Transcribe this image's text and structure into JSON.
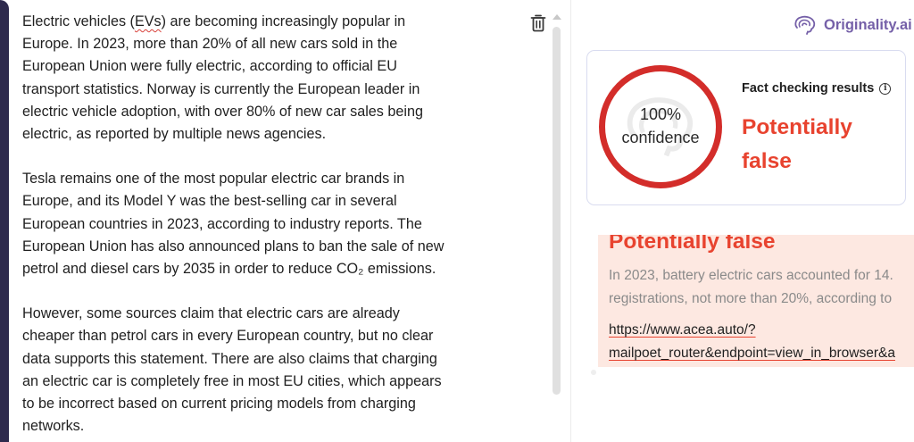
{
  "editor": {
    "paragraphs": [
      {
        "lines": [
          "Electric vehicles (EVs) are becoming increasingly popular in",
          "Europe. In 2023, more than 20% of all new cars sold in the",
          "European Union were fully electric, according to official EU",
          "transport statistics. Norway is currently the European leader in",
          "electric vehicle adoption, with over 80% of new car sales being",
          "electric, as reported by multiple news agencies."
        ],
        "line0_before": "Electric vehicles (",
        "line0_misspelled": "EVs",
        "line0_after": ") are becoming increasingly popular in"
      },
      {
        "lines": [
          "Tesla remains one of the most popular electric car brands in",
          "Europe, and its Model Y was the best-selling car in several",
          "European countries in 2023, according to industry reports. The",
          "European Union has also announced plans to ban the sale of new",
          "petrol and diesel cars by 2035 in order to reduce CO₂ emissions."
        ]
      },
      {
        "lines": [
          "However, some sources claim that electric cars are already",
          "cheaper than petrol cars in every European country, but no clear",
          "data supports this statement. There are also claims that charging",
          "an electric car is completely free in most EU cities, which appears",
          "to be incorrect based on current pricing models from charging",
          "networks."
        ]
      }
    ],
    "delete_icon": "trash-icon"
  },
  "brand": {
    "name": "Originality.ai",
    "icon": "brain-icon",
    "color": "#7560a8"
  },
  "fact_check": {
    "confidence_value": "100%",
    "confidence_label": "confidence",
    "title": "Fact checking results",
    "info_icon": "info-icon",
    "info_glyph": "i",
    "verdict_line1": "Potentially",
    "verdict_line2": "false",
    "verdict_color": "#e8432f",
    "ring_color": "#d32d2a"
  },
  "result": {
    "title": "Potentially false",
    "body_line1": "In 2023, battery electric cars accounted for 14.",
    "body_line2": "registrations, not more than 20%, according to",
    "link_line1": "https://www.acea.auto/?",
    "link_line2": "mailpoet_router&endpoint=view_in_browser&a",
    "background": "#fde8e1"
  }
}
